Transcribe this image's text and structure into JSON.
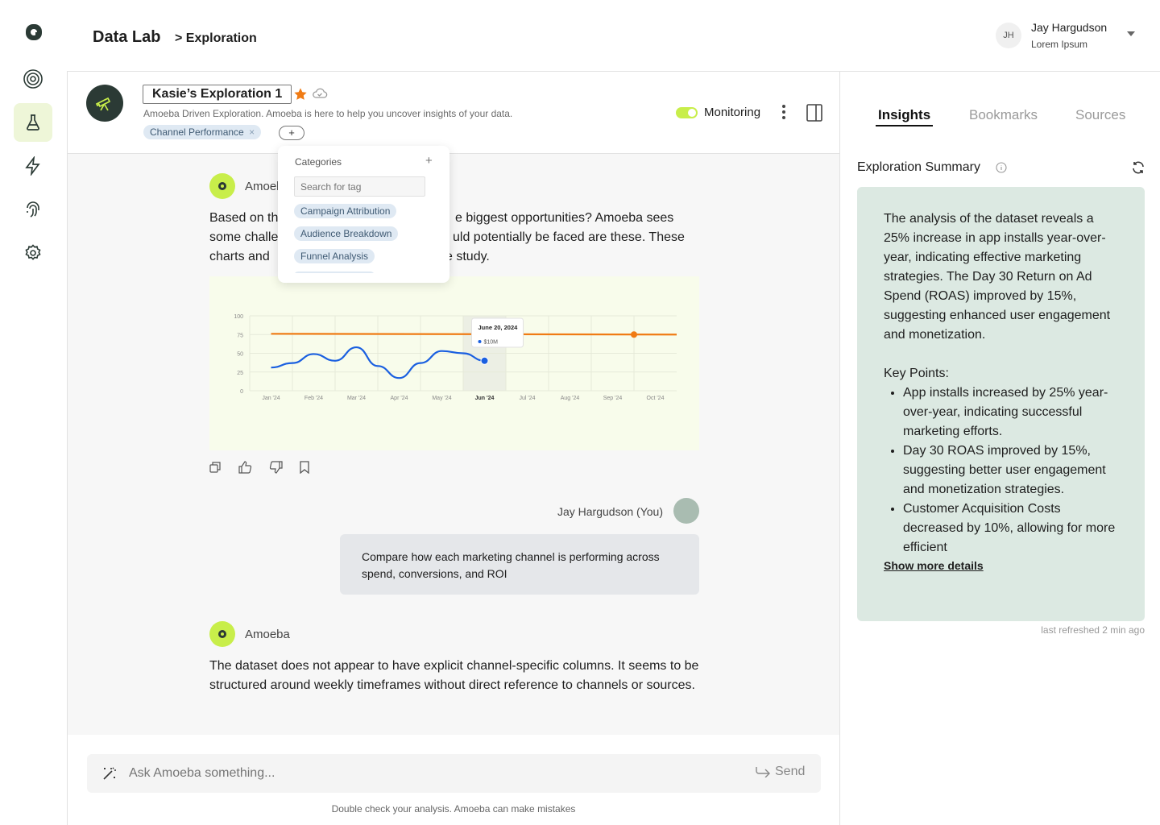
{
  "header": {
    "app_title": "Data Lab",
    "breadcrumb": "> Exploration",
    "user": {
      "initials": "JH",
      "name": "Jay Hargudson",
      "subtitle": "Lorem Ipsum"
    }
  },
  "rail": {
    "icons": [
      "logo-icon",
      "radar-icon",
      "flask-icon",
      "lightning-icon",
      "fingerprint-icon",
      "gear-icon"
    ],
    "active": "flask-icon",
    "accent": "#c8ee4a"
  },
  "exploration": {
    "title": "Kasie’s Exploration 1",
    "description": "Amoeba Driven Exploration. Amoeba is here to help you uncover insights of your data.",
    "tag": "Channel Performance",
    "tag_remove": "×",
    "add_tag_label": "+",
    "monitoring_label": "Monitoring",
    "monitoring_on": true,
    "star_color": "#f07b14"
  },
  "tag_popover": {
    "title": "Categories",
    "add_label": "+",
    "search_placeholder": "Search for tag",
    "options": [
      "Campaign Attribution",
      "Audience Breakdown",
      "Funnel Analysis"
    ]
  },
  "messages": [
    {
      "author": "Amoeba",
      "visible_author": "Amoel",
      "lines": [
        "Based on th",
        "e biggest opportunities? Amoeba sees",
        "some challe",
        "uld potentially be faced are these. These",
        "charts and",
        "e study."
      ]
    },
    {
      "author": "Jay Hargudson (You)",
      "text": "Compare how each marketing channel is performing across spend, conversions, and ROI"
    },
    {
      "author": "Amoeba",
      "text": "The dataset does not appear to have explicit channel-specific columns. It seems to be structured around weekly timeframes without direct reference to channels or sources."
    }
  ],
  "chart_data": {
    "type": "line",
    "title": "",
    "xlabel": "",
    "ylabel": "",
    "categories": [
      "Jan '24",
      "Feb '24",
      "Mar '24",
      "Apr '24",
      "May '24",
      "Jun '24",
      "Jul '24",
      "Aug '24",
      "Sep '24",
      "Oct '24"
    ],
    "highlight_category": "Jun '24",
    "yticks": [
      0,
      25,
      50,
      75,
      100
    ],
    "ylim": [
      0,
      100
    ],
    "grid": true,
    "background": "#f8fceb",
    "series": [
      {
        "color": "#1a5fe0",
        "x": [
          0,
          0.5,
          1,
          1.5,
          2,
          2.5,
          3,
          3.5,
          4,
          4.5,
          5
        ],
        "values": [
          31,
          37,
          49,
          40,
          58,
          33,
          17,
          37,
          53,
          50,
          40
        ]
      },
      {
        "color": "#f07b14",
        "x": [
          0,
          9.5
        ],
        "values": [
          76,
          75
        ],
        "marker_x": 8.5,
        "marker_value": 75
      }
    ],
    "tooltip": {
      "date": "June 20, 2024",
      "value": "$10M",
      "x": 5,
      "value_y": 40
    }
  },
  "message_actions": [
    "copy-icon",
    "thumbs-up-icon",
    "thumbs-down-icon",
    "bookmark-icon"
  ],
  "composer": {
    "placeholder": "Ask Amoeba something...",
    "send_label": "Send",
    "disclaimer": "Double check your analysis. Amoeba can make mistakes"
  },
  "right_panel": {
    "tabs": [
      "Insights",
      "Bookmarks",
      "Sources"
    ],
    "active_tab": "Insights",
    "summary_title": "Exploration Summary",
    "summary_paragraph": "The analysis of the dataset reveals a 25% increase in app installs year-over-year, indicating effective marketing strategies. The Day 30 Return on Ad Spend (ROAS) improved by 15%, suggesting enhanced user engagement and monetization.",
    "key_points_title": "Key Points:",
    "key_points": [
      "App installs increased by 25% year-over-year, indicating successful marketing efforts.",
      "Day 30 ROAS improved by 15%, suggesting better user engagement and monetization strategies.",
      "Customer Acquisition Costs decreased by 10%, allowing for more efficient"
    ],
    "show_more": "Show more details",
    "last_refreshed": "last refreshed 2 min ago",
    "card_color": "#dce9e2"
  }
}
